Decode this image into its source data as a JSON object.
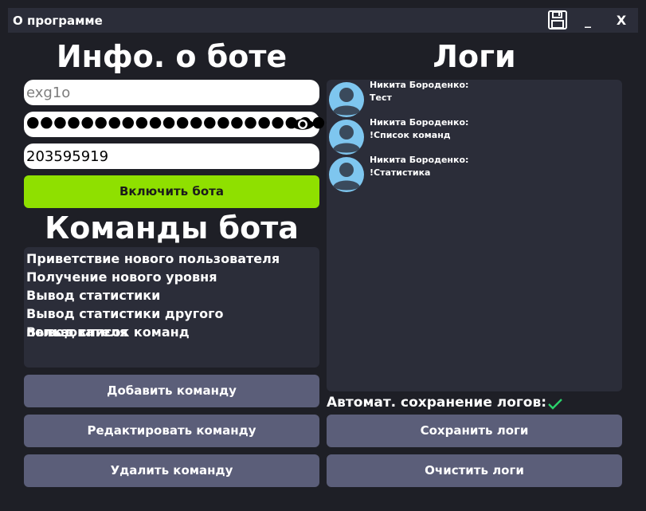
{
  "window": {
    "title": "О программе",
    "minimize_label": "_",
    "close_label": "X"
  },
  "bot_info": {
    "heading": "Инфо. о боте",
    "login_value": "exg1o",
    "password_masked": "●●●●●●●●●●●●●●●●●●●●●●●●●●",
    "id_value": "203595919",
    "enable_button": "Включить бота"
  },
  "commands": {
    "heading": "Команды бота",
    "items": [
      "Приветствие нового пользователя",
      "Получение нового уровня",
      "Вывод статистики",
      "Вывод статистики другого пользователя",
      "Вывод список команд"
    ],
    "add_button": "Добавить команду",
    "edit_button": "Редактировать команду",
    "delete_button": "Удалить команду"
  },
  "logs": {
    "heading": "Логи",
    "entries": [
      {
        "author": "Никита Бороденко:",
        "message": "Тест"
      },
      {
        "author": "Никита Бороденко:",
        "message": "!Список команд"
      },
      {
        "author": "Никита Бороденко:",
        "message": "!Статистика"
      }
    ],
    "autosave_label": "Автомат. сохранение логов:",
    "autosave_enabled": true,
    "save_button": "Сохранить логи",
    "clear_button": "Очистить логи"
  },
  "colors": {
    "background": "#1e1f26",
    "panel": "#2b2d39",
    "button": "#5b5e79",
    "enable_button": "#8fe000",
    "check": "#2bd16b",
    "avatar_bg": "#7ec6ef"
  }
}
